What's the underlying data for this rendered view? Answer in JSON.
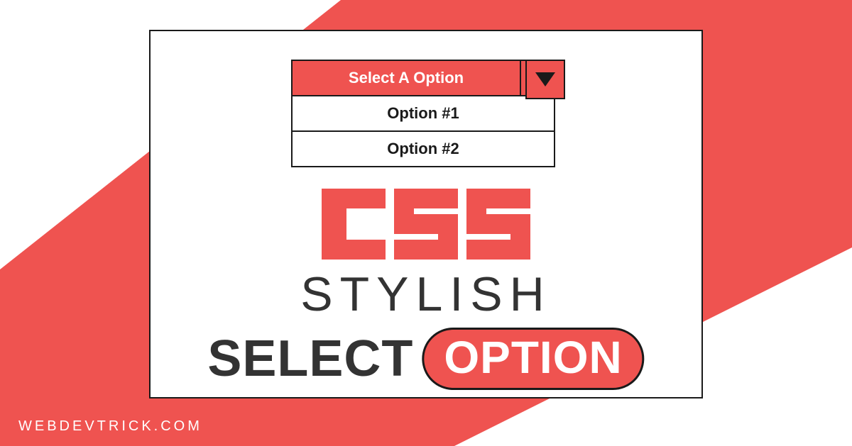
{
  "colors": {
    "accent": "#ef5350",
    "dark": "#1a1a1a",
    "text": "#333333"
  },
  "select": {
    "placeholder": "Select A Option",
    "options": [
      "Option #1",
      "Option #2"
    ]
  },
  "headline": {
    "line1": "CSS",
    "line2": "STYLISH",
    "line3_word1": "SELECT",
    "line3_word2": "OPTION"
  },
  "watermark": "WEBDEVTRICK.COM"
}
